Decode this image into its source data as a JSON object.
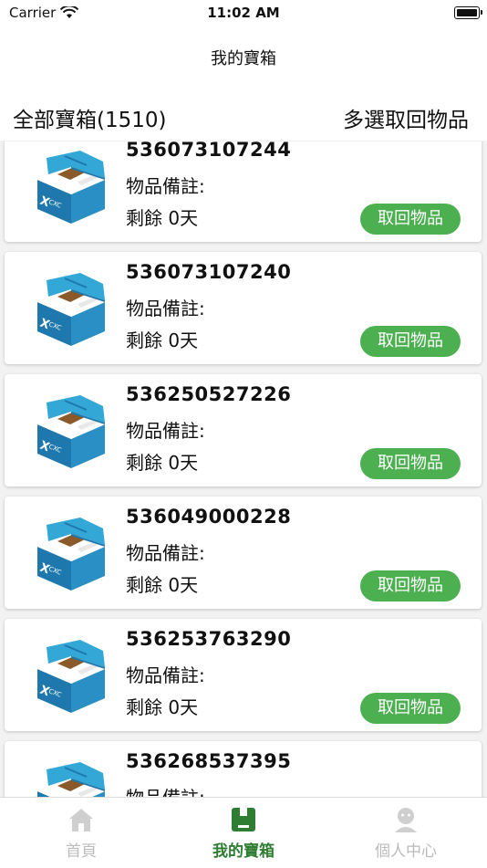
{
  "status_bar": {
    "carrier": "Carrier",
    "time": "11:02 AM"
  },
  "nav": {
    "title": "我的寶箱"
  },
  "subheader": {
    "all_boxes": "全部寶箱(1510)",
    "multi_select": "多選取回物品"
  },
  "boxes": [
    {
      "id": "536073107244",
      "note_label": "物品備註:",
      "remaining": "剩餘 0天",
      "button": "取回物品"
    },
    {
      "id": "536073107240",
      "note_label": "物品備註:",
      "remaining": "剩餘 0天",
      "button": "取回物品"
    },
    {
      "id": "536250527226",
      "note_label": "物品備註:",
      "remaining": "剩餘 0天",
      "button": "取回物品"
    },
    {
      "id": "536049000228",
      "note_label": "物品備註:",
      "remaining": "剩餘 0天",
      "button": "取回物品"
    },
    {
      "id": "536253763290",
      "note_label": "物品備註:",
      "remaining": "剩餘 0天",
      "button": "取回物品"
    },
    {
      "id": "536268537395",
      "note_label": "物品備註:",
      "remaining": "",
      "button": ""
    }
  ],
  "tabs": [
    {
      "label": "首頁",
      "icon": "home-icon"
    },
    {
      "label": "我的寶箱",
      "icon": "box-icon"
    },
    {
      "label": "個人中心",
      "icon": "person-icon"
    }
  ],
  "colors": {
    "accent": "#4caf50",
    "active_tab": "#2e7d32",
    "box_blue": "#2a8fc4"
  }
}
